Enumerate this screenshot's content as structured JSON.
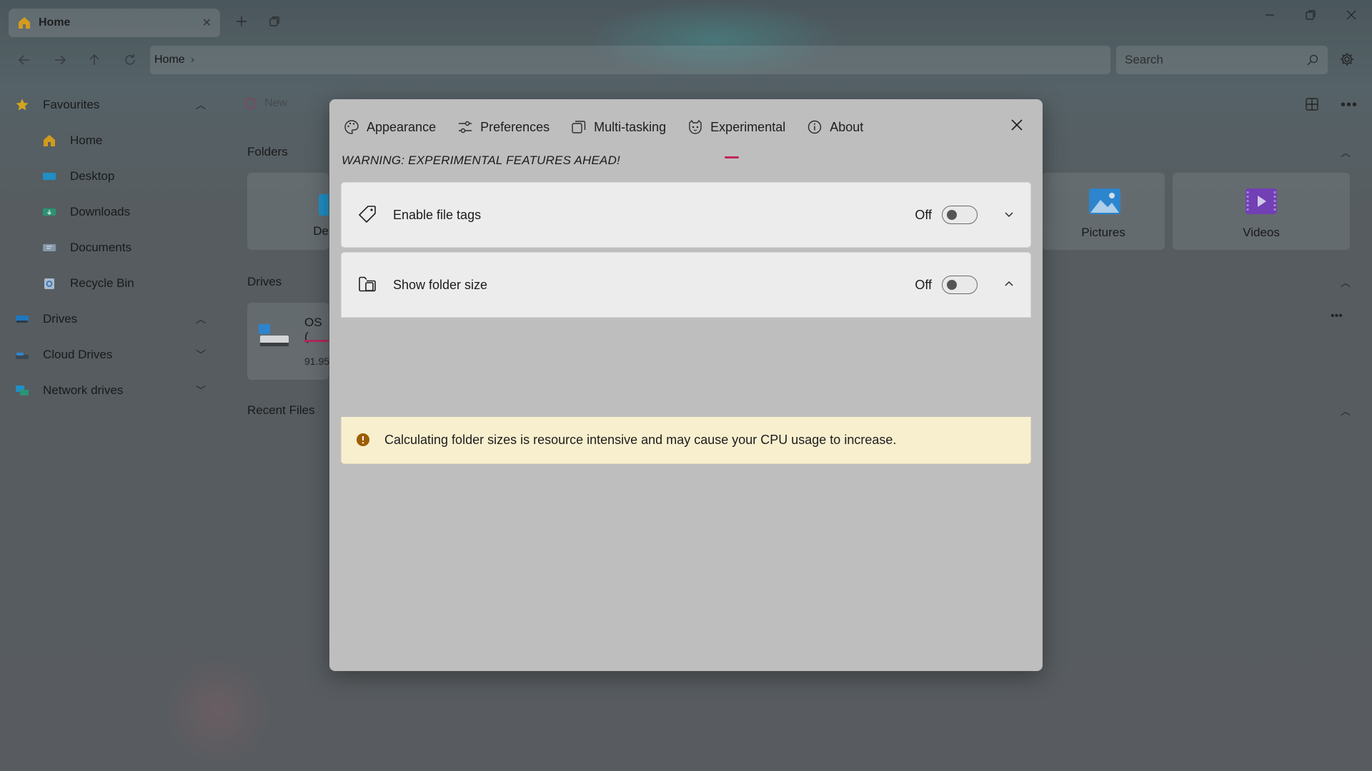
{
  "window": {
    "tab_label": "Home",
    "tab_close_icon": "close-icon",
    "new_tab_icon": "plus-icon",
    "controls": [
      "minimize-icon",
      "restore-icon",
      "close-icon"
    ]
  },
  "nav": {
    "buttons": [
      "back-arrow-icon",
      "forward-arrow-icon",
      "up-arrow-icon",
      "refresh-icon"
    ],
    "breadcrumb": "Home",
    "breadcrumb_separator": "›",
    "search_placeholder": "Search"
  },
  "sidebar": {
    "items": [
      {
        "label": "Favourites",
        "icon": "star-icon",
        "level": 0,
        "chevron": "up"
      },
      {
        "label": "Home",
        "icon": "home-icon",
        "level": 1
      },
      {
        "label": "Desktop",
        "icon": "desktop-icon",
        "level": 1
      },
      {
        "label": "Downloads",
        "icon": "downloads-icon",
        "level": 1
      },
      {
        "label": "Documents",
        "icon": "documents-icon",
        "level": 1
      },
      {
        "label": "Recycle Bin",
        "icon": "recycle-bin-icon",
        "level": 1
      },
      {
        "label": "Drives",
        "icon": "drives-icon",
        "level": 0,
        "chevron": "up"
      },
      {
        "label": "Cloud Drives",
        "icon": "cloud-drives-icon",
        "level": 0,
        "chevron": "down"
      },
      {
        "label": "Network drives",
        "icon": "network-drives-icon",
        "level": 0,
        "chevron": "down"
      }
    ]
  },
  "content": {
    "toolbar_new": "New",
    "folders_heading": "Folders",
    "drives_heading": "Drives",
    "recent_heading": "Recent Files",
    "folder_card_partial": "De",
    "pictures_label": "Pictures",
    "videos_label": "Videos",
    "drive_name_partial": "OS (",
    "drive_size_partial": "91.95"
  },
  "dialog": {
    "tabs": [
      {
        "label": "Appearance",
        "icon": "palette-icon"
      },
      {
        "label": "Preferences",
        "icon": "sliders-icon"
      },
      {
        "label": "Multi-tasking",
        "icon": "multitasking-icon"
      },
      {
        "label": "Experimental",
        "icon": "flask-icon",
        "active": true
      },
      {
        "label": "About",
        "icon": "info-icon"
      }
    ],
    "warning": "WARNING: EXPERIMENTAL FEATURES AHEAD!",
    "settings": [
      {
        "label": "Enable file tags",
        "icon": "tag-icon",
        "state": "Off",
        "enabled": false,
        "expanded": false
      },
      {
        "label": "Show folder size",
        "icon": "folder-size-icon",
        "state": "Off",
        "enabled": false,
        "expanded": true
      }
    ],
    "folder_size_info": "Calculating folder sizes is resource intensive and may cause your CPU usage to increase.",
    "colors": {
      "accent": "#c2255c",
      "info_icon": "#9d5d00",
      "infobar_bg": "#f8efcf"
    }
  }
}
